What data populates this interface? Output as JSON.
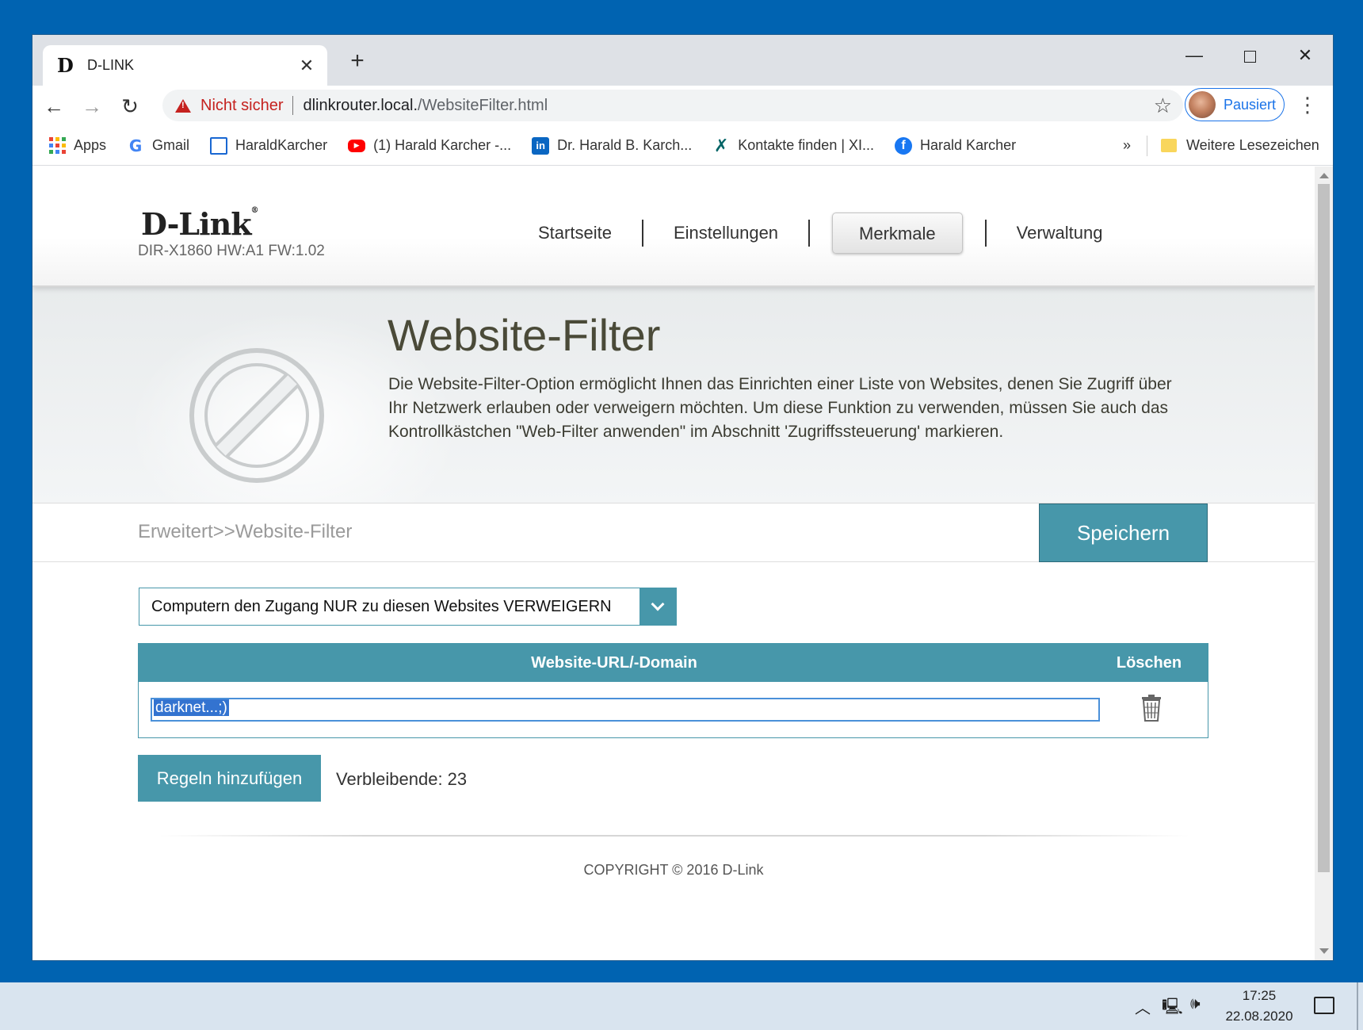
{
  "browser": {
    "tab_title": "D-LINK",
    "tab_favicon": "D",
    "new_tab_label": "+",
    "security_label": "Nicht sicher",
    "url_host": "dlinkrouter.local.",
    "url_path": "/WebsiteFilter.html",
    "profile_label": "Pausiert",
    "bookmarks": [
      {
        "label": "Apps",
        "icon": "apps-grid-icon"
      },
      {
        "label": "Gmail",
        "icon": "google-icon"
      },
      {
        "label": "HaraldKarcher",
        "icon": "page-icon"
      },
      {
        "label": "(1) Harald Karcher -...",
        "icon": "youtube-icon"
      },
      {
        "label": "Dr. Harald B. Karch...",
        "icon": "linkedin-icon"
      },
      {
        "label": "Kontakte finden | XI...",
        "icon": "xing-icon"
      },
      {
        "label": "Harald Karcher",
        "icon": "facebook-icon"
      }
    ],
    "more_bookmarks": "»",
    "other_bookmarks": "Weitere Lesezeichen"
  },
  "router": {
    "brand": "D-Link",
    "model": "DIR-X1860 HW:A1 FW:1.02",
    "nav": [
      "Startseite",
      "Einstellungen",
      "Merkmale",
      "Verwaltung"
    ],
    "active_nav": "Merkmale"
  },
  "page": {
    "title": "Website-Filter",
    "description": "Die Website-Filter-Option ermöglicht Ihnen das Einrichten einer Liste von Websites, denen Sie Zugriff über Ihr Netzwerk erlauben oder verweigern möchten. Um diese Funktion zu verwenden, müssen Sie auch das Kontrollkästchen \"Web-Filter anwenden\" im Abschnitt 'Zugriffssteuerung' markieren.",
    "breadcrumb": "Erweitert>>Website-Filter",
    "save_label": "Speichern",
    "mode_selected": "Computern den Zugang NUR zu diesen Websites VERWEIGERN",
    "table": {
      "col_url": "Website-URL/-Domain",
      "col_delete": "Löschen",
      "rows": [
        {
          "url": "darknet...;)"
        }
      ]
    },
    "add_rule_label": "Regeln hinzufügen",
    "remaining": "Verbleibende: 23",
    "copyright": "COPYRIGHT © 2016 D-Link"
  },
  "taskbar": {
    "time": "17:25",
    "date": "22.08.2020"
  },
  "colors": {
    "accent": "#4797AA",
    "desktop": "#0063B1",
    "insecure": "#C5221F"
  }
}
